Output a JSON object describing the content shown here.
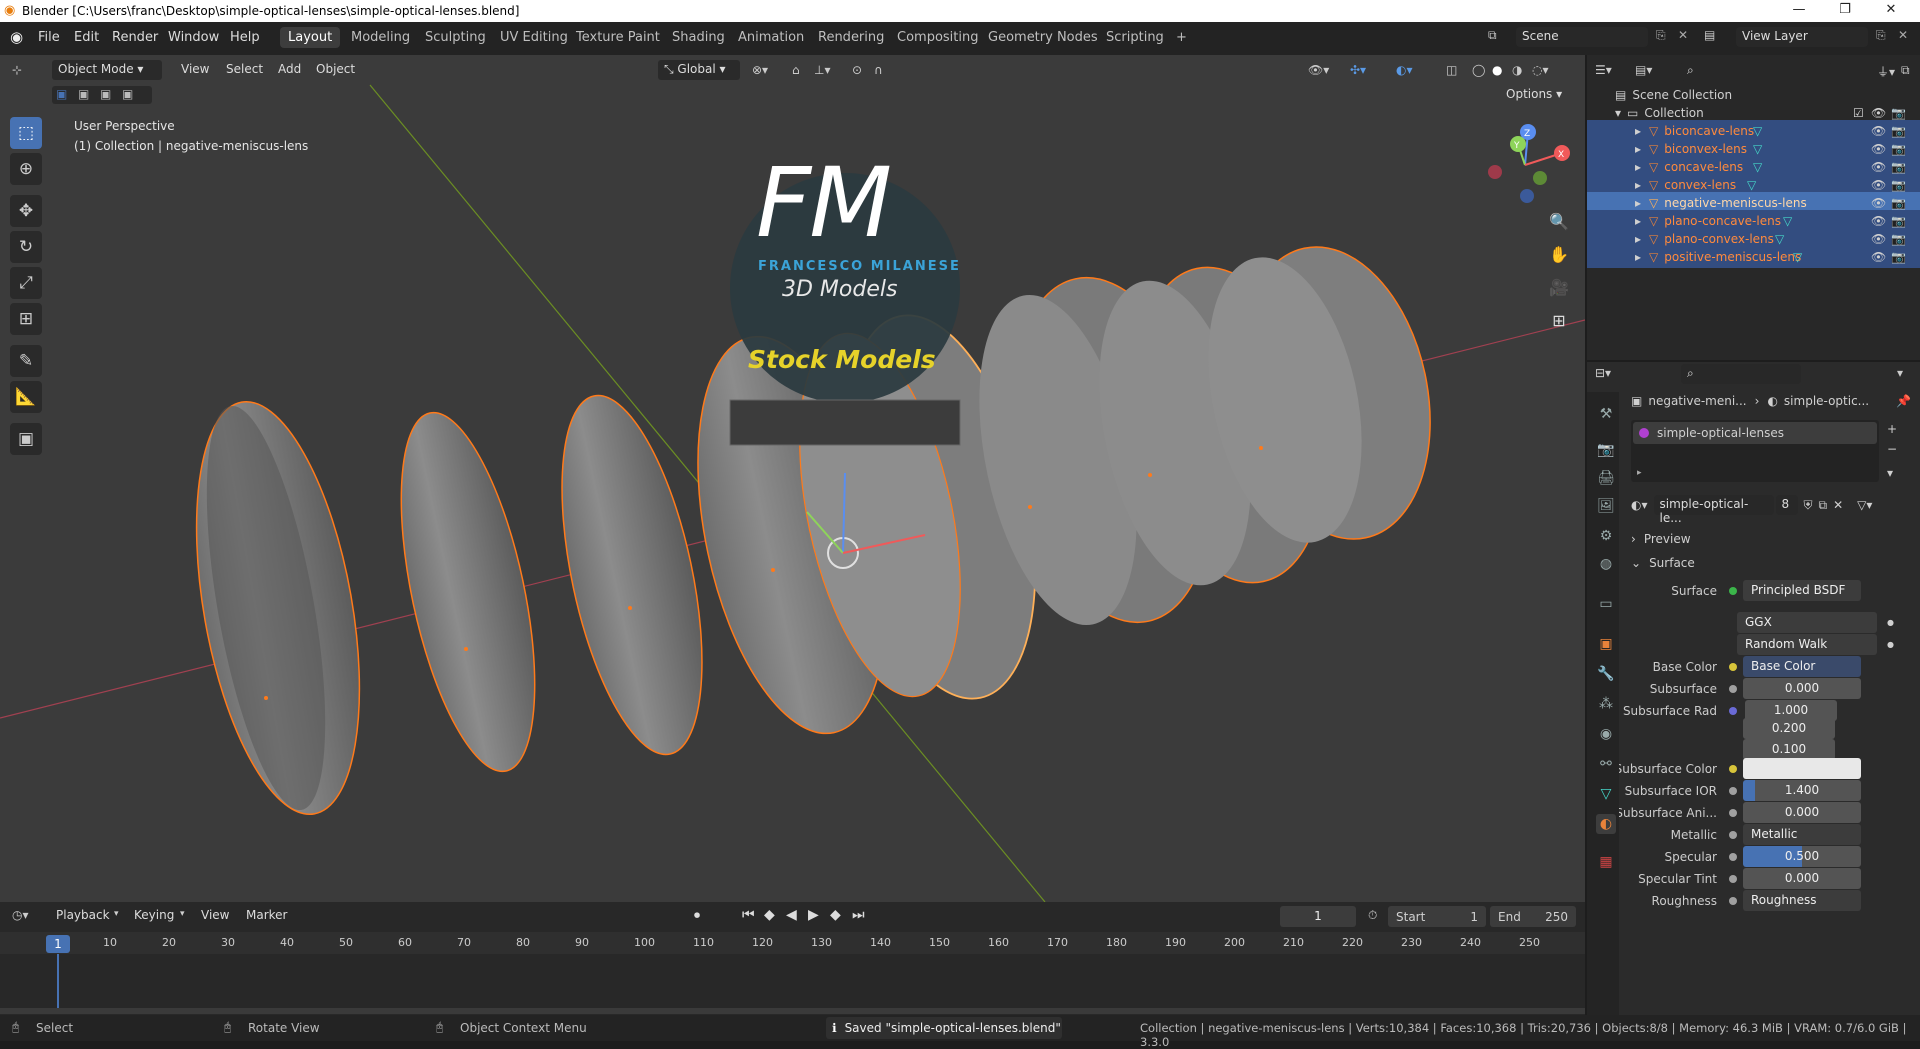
{
  "window": {
    "title": "Blender [C:\\Users\\franc\\Desktop\\simple-optical-lenses\\simple-optical-lenses.blend]",
    "min": "—",
    "max": "❐",
    "close": "✕"
  },
  "menu": [
    "File",
    "Edit",
    "Render",
    "Window",
    "Help"
  ],
  "workspaces": [
    "Layout",
    "Modeling",
    "Sculpting",
    "UV Editing",
    "Texture Paint",
    "Shading",
    "Animation",
    "Rendering",
    "Compositing",
    "Geometry Nodes",
    "Scripting"
  ],
  "workspace_add": "+",
  "scene": {
    "label": "Scene",
    "view_layer": "View Layer"
  },
  "viewport_header": {
    "mode": "Object Mode",
    "menus": [
      "View",
      "Select",
      "Add",
      "Object"
    ],
    "transform": "Global",
    "options": "Options"
  },
  "viewport": {
    "view_name": "User Perspective",
    "collection_info": "(1) Collection | negative-meniscus-lens"
  },
  "watermark": {
    "big": "FM",
    "name": "FRANCESCO MILANESE",
    "sub": "3D Models",
    "banner": "Stock Models"
  },
  "gizmo": {
    "x": "X",
    "y": "Y",
    "z": "Z"
  },
  "outliner": {
    "scene_collection": "Scene Collection",
    "collection": "Collection",
    "items": [
      {
        "name": "biconcave-lens",
        "state": "selected"
      },
      {
        "name": "biconvex-lens",
        "state": "selected"
      },
      {
        "name": "concave-lens",
        "state": "selected"
      },
      {
        "name": "convex-lens",
        "state": "selected"
      },
      {
        "name": "negative-meniscus-lens",
        "state": "active"
      },
      {
        "name": "plano-concave-lens",
        "state": "selected"
      },
      {
        "name": "plano-convex-lens",
        "state": "selected"
      },
      {
        "name": "positive-meniscus-lens",
        "state": "selected"
      }
    ]
  },
  "properties": {
    "breadcrumb_object": "negative-meni...",
    "breadcrumb_material": "simple-optic...",
    "material_slot": "simple-optical-lenses",
    "material_name": "simple-optical-le...",
    "user_count": "8",
    "sections": {
      "preview": "Preview",
      "surface": "Surface"
    },
    "surface_label": "Surface",
    "surface_value": "Principled BSDF",
    "distribution": "GGX",
    "subsurface_method": "Random Walk",
    "fields": {
      "base_color": {
        "label": "Base Color",
        "value": "Base Color"
      },
      "subsurface": {
        "label": "Subsurface",
        "value": "0.000"
      },
      "subsurface_radius": {
        "label": "Subsurface Rad",
        "values": [
          "1.000",
          "0.200",
          "0.100"
        ]
      },
      "subsurface_color": {
        "label": "Subsurface Color",
        "value": "#e8e8e8"
      },
      "subsurface_ior": {
        "label": "Subsurface IOR",
        "value": "1.400"
      },
      "subsurface_aniso": {
        "label": "Subsurface Ani...",
        "value": "0.000"
      },
      "metallic": {
        "label": "Metallic",
        "value": "Metallic"
      },
      "specular": {
        "label": "Specular",
        "value": "0.500"
      },
      "specular_tint": {
        "label": "Specular Tint",
        "value": "0.000"
      },
      "roughness": {
        "label": "Roughness",
        "value": "Roughness"
      }
    }
  },
  "timeline": {
    "menus": [
      "Playback",
      "Keying",
      "View",
      "Marker"
    ],
    "current_frame": "1",
    "start_label": "Start",
    "start": "1",
    "end_label": "End",
    "end": "250",
    "ticks": [
      "10",
      "20",
      "30",
      "40",
      "50",
      "60",
      "70",
      "80",
      "90",
      "100",
      "110",
      "120",
      "130",
      "140",
      "150",
      "160",
      "170",
      "180",
      "190",
      "200",
      "210",
      "220",
      "230",
      "240",
      "250"
    ]
  },
  "statusbar": {
    "select": "Select",
    "rotate": "Rotate View",
    "context": "Object Context Menu",
    "saved": "Saved \"simple-optical-lenses.blend\"",
    "stats": "Collection | negative-meniscus-lens | Verts:10,384 | Faces:10,368 | Tris:20,736 | Objects:8/8 | Memory: 46.3 MiB | VRAM: 0.7/6.0 GiB | 3.3.0"
  },
  "colors": {
    "accent": "#4772b3",
    "selection": "#ff8a3d",
    "active_row": "#334d80"
  }
}
